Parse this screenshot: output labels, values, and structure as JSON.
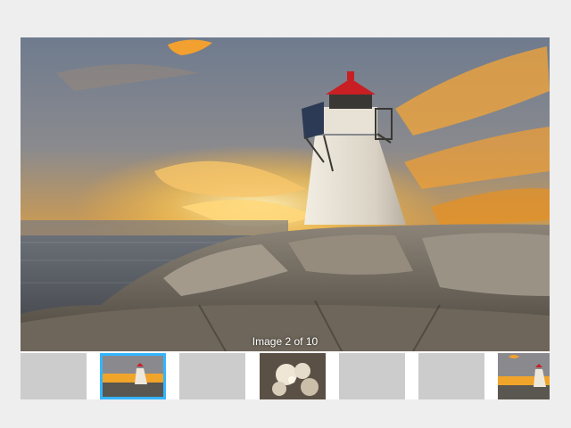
{
  "caption": "Image 2 of 10",
  "colors": {
    "selected_border": "#33b5ff",
    "placeholder": "#cccccc"
  },
  "thumbnails": [
    {
      "kind": "placeholder"
    },
    {
      "kind": "lighthouse",
      "selected": true
    },
    {
      "kind": "placeholder"
    },
    {
      "kind": "flowers"
    },
    {
      "kind": "placeholder"
    },
    {
      "kind": "placeholder"
    },
    {
      "kind": "lighthouse"
    }
  ]
}
